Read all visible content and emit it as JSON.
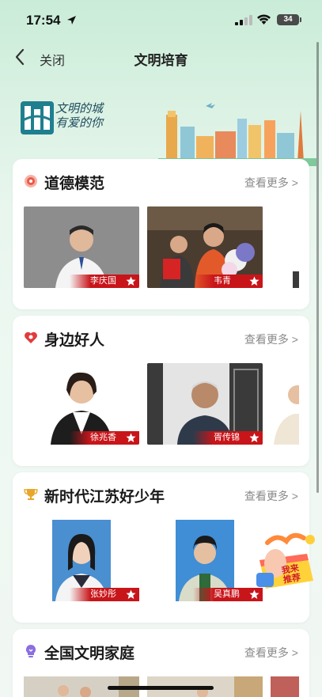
{
  "status_bar": {
    "time": "17:54",
    "battery": "34"
  },
  "nav": {
    "close_label": "关闭",
    "title": "文明培育"
  },
  "banner": {
    "logo_text_line1": "文明的城",
    "logo_text_line2": "有爱的你"
  },
  "sections": [
    {
      "title": "道德模范",
      "more": "查看更多 >",
      "people": [
        {
          "name": "李庆国"
        },
        {
          "name": "韦青"
        }
      ]
    },
    {
      "title": "身边好人",
      "more": "查看更多 >",
      "people": [
        {
          "name": "徐兆香"
        },
        {
          "name": "胥传锦"
        }
      ]
    },
    {
      "title": "新时代江苏好少年",
      "more": "查看更多 >",
      "people": [
        {
          "name": "张妙彤"
        },
        {
          "name": "吴真鹏"
        }
      ]
    },
    {
      "title": "全国文明家庭",
      "more": "查看更多 >",
      "people": []
    }
  ],
  "float_badge": {
    "line1": "我来",
    "line2": "推荐"
  },
  "colors": {
    "accent_red": "#c8151a",
    "background_green": "#d9f1e2"
  }
}
